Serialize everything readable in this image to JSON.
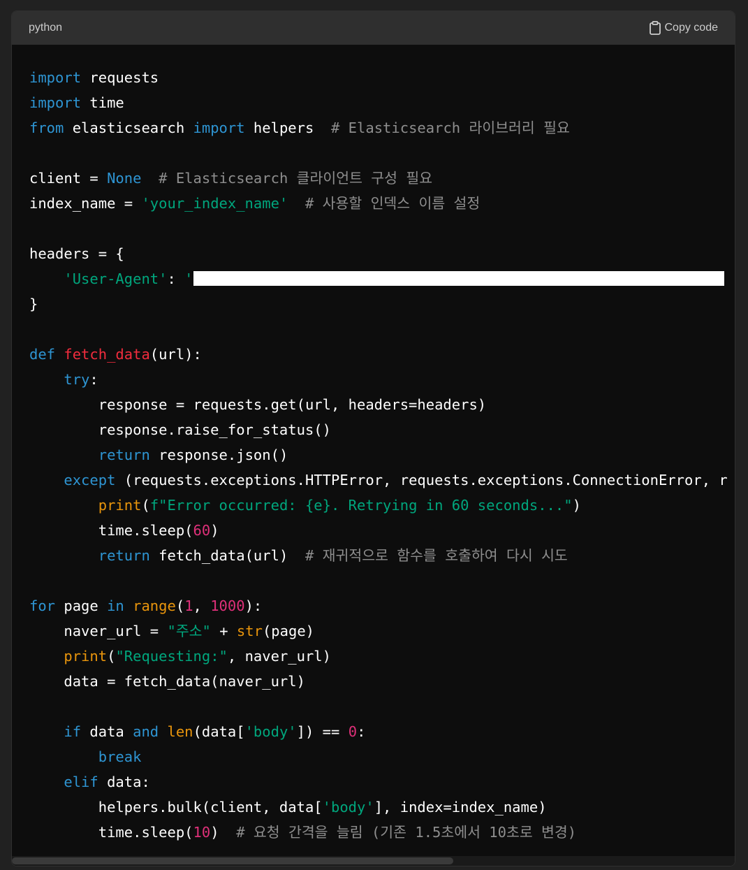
{
  "header": {
    "language": "python",
    "copy_label": "Copy code",
    "copy_icon": "clipboard-icon"
  },
  "code": {
    "lines": [
      [
        {
          "t": "import",
          "c": "kw"
        },
        {
          "t": " requests",
          "c": ""
        }
      ],
      [
        {
          "t": "import",
          "c": "kw"
        },
        {
          "t": " time",
          "c": ""
        }
      ],
      [
        {
          "t": "from",
          "c": "kw"
        },
        {
          "t": " elasticsearch ",
          "c": ""
        },
        {
          "t": "import",
          "c": "kw"
        },
        {
          "t": " helpers  ",
          "c": ""
        },
        {
          "t": "# Elasticsearch 라이브러리 필요",
          "c": "cm"
        }
      ],
      [],
      [
        {
          "t": "client = ",
          "c": ""
        },
        {
          "t": "None",
          "c": "kw"
        },
        {
          "t": "  ",
          "c": ""
        },
        {
          "t": "# Elasticsearch 클라이언트 구성 필요",
          "c": "cm"
        }
      ],
      [
        {
          "t": "index_name = ",
          "c": ""
        },
        {
          "t": "'your_index_name'",
          "c": "str"
        },
        {
          "t": "  ",
          "c": ""
        },
        {
          "t": "# 사용할 인덱스 이름 설정",
          "c": "cm"
        }
      ],
      [],
      [
        {
          "t": "headers = {",
          "c": ""
        }
      ],
      [
        {
          "t": "    ",
          "c": ""
        },
        {
          "t": "'User-Agent'",
          "c": "str"
        },
        {
          "t": ": ",
          "c": ""
        },
        {
          "t": "'",
          "c": "str"
        },
        {
          "redact": true
        }
      ],
      [
        {
          "t": "}",
          "c": ""
        }
      ],
      [],
      [
        {
          "t": "def",
          "c": "kw"
        },
        {
          "t": " ",
          "c": ""
        },
        {
          "t": "fetch_data",
          "c": "fn"
        },
        {
          "t": "(url):",
          "c": ""
        }
      ],
      [
        {
          "t": "    ",
          "c": ""
        },
        {
          "t": "try",
          "c": "kw"
        },
        {
          "t": ":",
          "c": ""
        }
      ],
      [
        {
          "t": "        response = requests.get(url, headers=headers)",
          "c": ""
        }
      ],
      [
        {
          "t": "        response.raise_for_status()",
          "c": ""
        }
      ],
      [
        {
          "t": "        ",
          "c": ""
        },
        {
          "t": "return",
          "c": "kw"
        },
        {
          "t": " response.json()",
          "c": ""
        }
      ],
      [
        {
          "t": "    ",
          "c": ""
        },
        {
          "t": "except",
          "c": "kw"
        },
        {
          "t": " (requests.exceptions.HTTPError, requests.exceptions.ConnectionError, r",
          "c": ""
        }
      ],
      [
        {
          "t": "        ",
          "c": ""
        },
        {
          "t": "print",
          "c": "bi"
        },
        {
          "t": "(",
          "c": ""
        },
        {
          "t": "f\"Error occurred: {e}. Retrying in 60 seconds...\"",
          "c": "str"
        },
        {
          "t": ")",
          "c": ""
        }
      ],
      [
        {
          "t": "        time.sleep(",
          "c": ""
        },
        {
          "t": "60",
          "c": "num"
        },
        {
          "t": ")",
          "c": ""
        }
      ],
      [
        {
          "t": "        ",
          "c": ""
        },
        {
          "t": "return",
          "c": "kw"
        },
        {
          "t": " fetch_data(url)  ",
          "c": ""
        },
        {
          "t": "# 재귀적으로 함수를 호출하여 다시 시도",
          "c": "cm"
        }
      ],
      [],
      [
        {
          "t": "for",
          "c": "kw"
        },
        {
          "t": " page ",
          "c": ""
        },
        {
          "t": "in",
          "c": "kw"
        },
        {
          "t": " ",
          "c": ""
        },
        {
          "t": "range",
          "c": "bi"
        },
        {
          "t": "(",
          "c": ""
        },
        {
          "t": "1",
          "c": "num"
        },
        {
          "t": ", ",
          "c": ""
        },
        {
          "t": "1000",
          "c": "num"
        },
        {
          "t": "):",
          "c": ""
        }
      ],
      [
        {
          "t": "    naver_url = ",
          "c": ""
        },
        {
          "t": "\"주소\"",
          "c": "str"
        },
        {
          "t": " + ",
          "c": ""
        },
        {
          "t": "str",
          "c": "bi"
        },
        {
          "t": "(page)",
          "c": ""
        }
      ],
      [
        {
          "t": "    ",
          "c": ""
        },
        {
          "t": "print",
          "c": "bi"
        },
        {
          "t": "(",
          "c": ""
        },
        {
          "t": "\"Requesting:\"",
          "c": "str"
        },
        {
          "t": ", naver_url)",
          "c": ""
        }
      ],
      [
        {
          "t": "    data = fetch_data(naver_url)",
          "c": ""
        }
      ],
      [],
      [
        {
          "t": "    ",
          "c": ""
        },
        {
          "t": "if",
          "c": "kw"
        },
        {
          "t": " data ",
          "c": ""
        },
        {
          "t": "and",
          "c": "kw"
        },
        {
          "t": " ",
          "c": ""
        },
        {
          "t": "len",
          "c": "bi"
        },
        {
          "t": "(data[",
          "c": ""
        },
        {
          "t": "'body'",
          "c": "str"
        },
        {
          "t": "]) == ",
          "c": ""
        },
        {
          "t": "0",
          "c": "num"
        },
        {
          "t": ":",
          "c": ""
        }
      ],
      [
        {
          "t": "        ",
          "c": ""
        },
        {
          "t": "break",
          "c": "kw"
        }
      ],
      [
        {
          "t": "    ",
          "c": ""
        },
        {
          "t": "elif",
          "c": "kw"
        },
        {
          "t": " data:",
          "c": ""
        }
      ],
      [
        {
          "t": "        helpers.bulk(client, data[",
          "c": ""
        },
        {
          "t": "'body'",
          "c": "str"
        },
        {
          "t": "], index=index_name)",
          "c": ""
        }
      ],
      [
        {
          "t": "        time.sleep(",
          "c": ""
        },
        {
          "t": "10",
          "c": "num"
        },
        {
          "t": ")  ",
          "c": ""
        },
        {
          "t": "# 요청 간격을 늘림 (기존 1.5초에서 10초로 변경)",
          "c": "cm"
        }
      ]
    ]
  },
  "colors": {
    "keyword": "#2e95d3",
    "function": "#f22c3d",
    "string": "#00a67d",
    "number": "#df3079",
    "builtin": "#e9950c",
    "comment": "#8e8e8e"
  }
}
